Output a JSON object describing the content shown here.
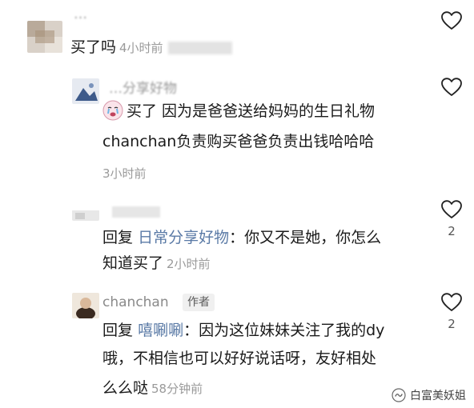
{
  "comments": [
    {
      "username": "…",
      "text": "买了吗",
      "time": "4小时前",
      "likes": ""
    },
    {
      "username": "…分享好物",
      "line1": "买了 因为是爸爸送给妈妈的生日礼物",
      "line2": "chanchan负责购买爸爸负责出钱哈哈哈",
      "time": "3小时前",
      "likes": ""
    },
    {
      "username": "",
      "reply_prefix": "回复",
      "reply_to": "日常分享好物",
      "line1": "：你又不是她，你怎么",
      "line2": "知道买了",
      "time": "2小时前",
      "likes": "2"
    },
    {
      "username": "chanchan",
      "badge": "作者",
      "reply_prefix": "回复",
      "reply_to": "嘻唰唰",
      "line1": "：因为这位妹妹关注了我的dy",
      "line2": "哦，不相信也可以好好说话呀，友好相处",
      "line3": "么么哒",
      "time": "58分钟前",
      "likes": "2"
    }
  ],
  "watermark": {
    "text": "白富美妖姐"
  }
}
